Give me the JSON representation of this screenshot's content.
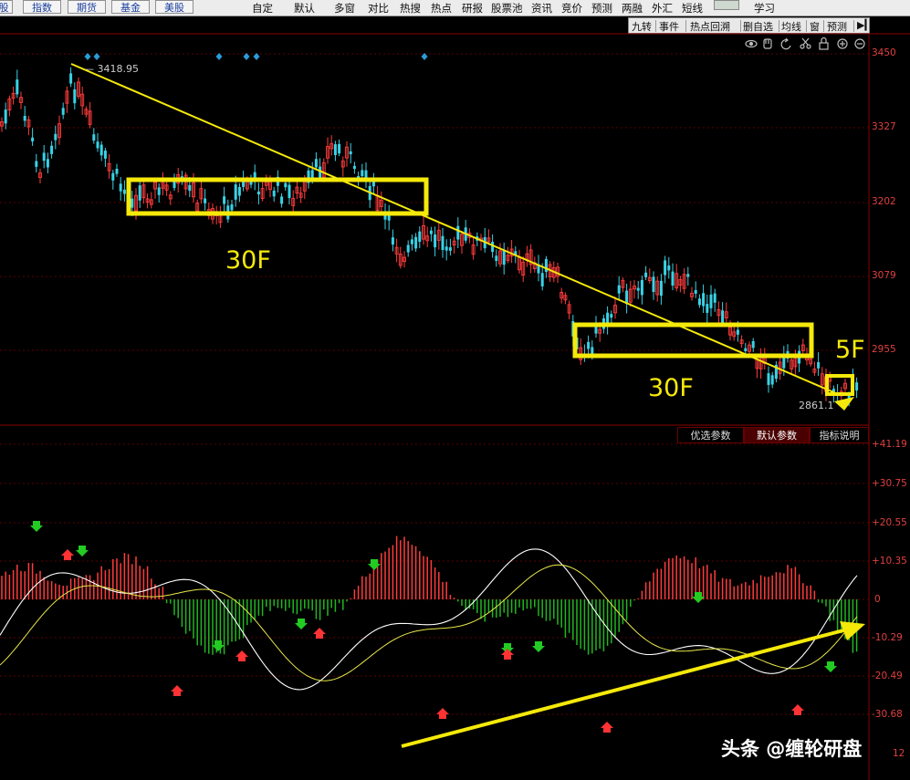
{
  "topbar": {
    "left_buttons": [
      "股",
      "指数",
      "期货",
      "基金",
      "美股"
    ],
    "menu": [
      "自定",
      "默认",
      "多窗",
      "对比",
      "热搜",
      "热点",
      "研报",
      "股票池",
      "资讯",
      "竞价",
      "预测",
      "两融",
      "外汇",
      "短线",
      "学习"
    ]
  },
  "toolbar2": {
    "items": [
      "九转",
      "事件",
      "热点回溯",
      "删自选",
      "均线",
      "窗",
      "预测"
    ]
  },
  "chart_icons": [
    "eye-icon",
    "hand-icon",
    "refresh-icon",
    "scissors-icon",
    "lock-icon",
    "zoom-in-icon",
    "zoom-out-icon"
  ],
  "param_tabs": [
    "优选参数",
    "默认参数",
    "指标说明"
  ],
  "price_axis": [
    "3450",
    "3327",
    "3202",
    "3079",
    "2955"
  ],
  "macd_axis": [
    "+41.19",
    "+30.75",
    "+20.55",
    "+10.35",
    "0",
    "-10.29",
    "-20.49",
    "-30.68",
    "12"
  ],
  "price_max_label": "3418.95",
  "price_min_label": "2861.1",
  "annotations": {
    "a1": "30F",
    "a2": "30F",
    "a3": "5F"
  },
  "watermark": "头条 @缠轮研盘",
  "colors": {
    "background": "#000000",
    "up": "#ff3c3c",
    "down": "#39d2e6",
    "macd_down": "#22b522",
    "annotation": "#f5e90a"
  }
}
